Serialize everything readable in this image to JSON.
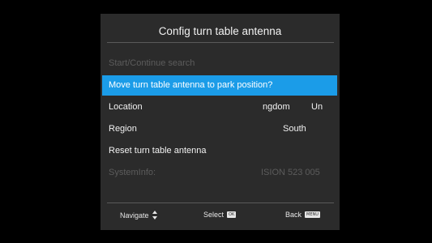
{
  "dialog": {
    "title": "Config turn table antenna"
  },
  "menu": {
    "start_search": "Start/Continue search",
    "move_park": "Move turn table antenna to park position?",
    "location_label": "Location",
    "location_value_left": "ngdom",
    "location_value_right": "Un",
    "region_label": "Region",
    "region_value": "South",
    "reset_label": "Reset turn table antenna",
    "systeminfo_label": "SystemInfo:",
    "systeminfo_value": "ISION 523 005"
  },
  "footer": {
    "navigate": "Navigate",
    "select": "Select",
    "select_key": "OK",
    "back": "Back",
    "back_key": "MENU"
  },
  "colors": {
    "highlight": "#1b9ce8",
    "panel": "#2b2b2b",
    "disabled_text": "#5c5c5c"
  },
  "icons": {
    "navigate": "up-down-arrows-icon",
    "select": "ok-key-icon",
    "back": "menu-key-icon"
  }
}
